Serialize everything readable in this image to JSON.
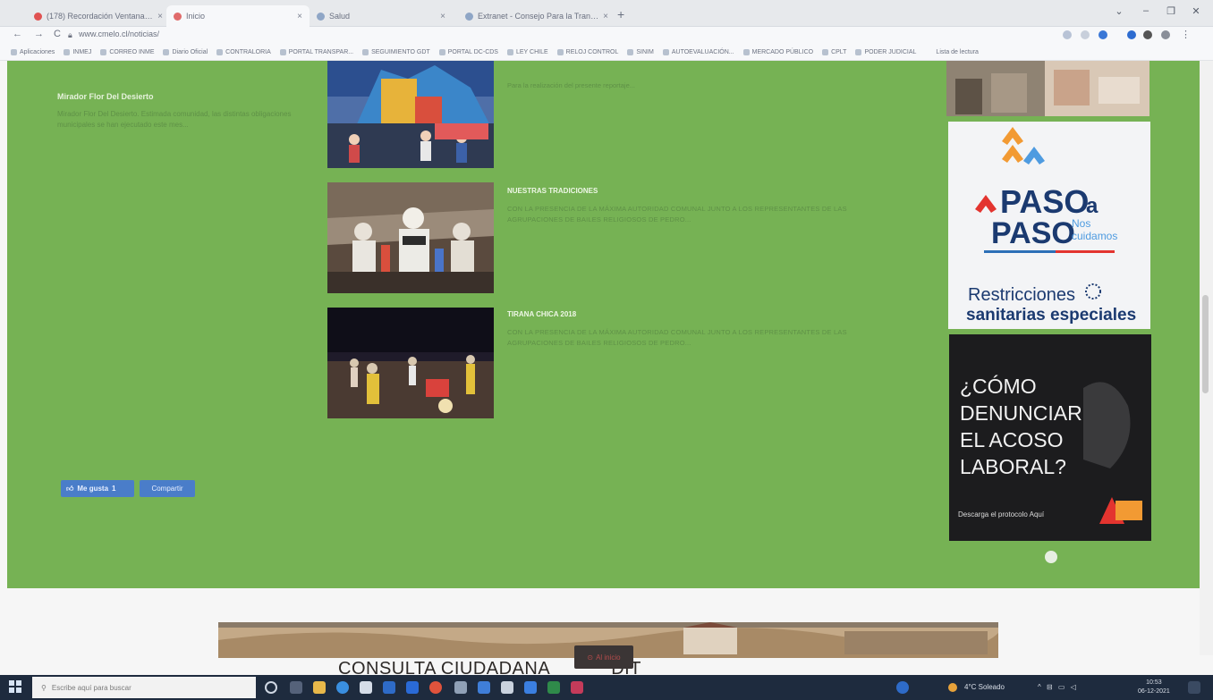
{
  "browser": {
    "tabs": [
      {
        "label": "(178) Recordación Ventanal - YouTube",
        "active": false
      },
      {
        "label": "Inicio",
        "active": true
      },
      {
        "label": "Salud",
        "active": false
      },
      {
        "label": "Extranet - Consejo Para la Transparencia",
        "active": false
      }
    ],
    "url": "www.cmelo.cl/noticias/",
    "bookmarks": [
      "Aplicaciones",
      "INMEJ",
      "CORREO INME",
      "Diario Oficial",
      "CONTRALORIA",
      "PORTAL TRANSPAR...",
      "SEGUIMIENTO GDT",
      "PORTAL DC-CDS",
      "LEY CHILE",
      "RELOJ CONTROL",
      "SINIM",
      "AUTOEVALUACIÓN...",
      "MERCADO PÚBLICO",
      "CPLT",
      "PODER JUDICIAL"
    ],
    "reading_list": "Lista de lectura"
  },
  "sidebar": {
    "title": "Mirador Flor Del Desierto",
    "text": "Mirador Flor Del Desierto. Estimada comunidad, las distintas obligaciones municipales se han ejecutado este mes..."
  },
  "news": {
    "clipped_text": "Para la realización del presente reportaje...",
    "items": [
      {
        "title": "NUESTRAS TRADICIONES",
        "text": "CON LA PRESENCIA DE LA MÁXIMA AUTORIDAD COMUNAL JUNTO A LOS REPRESENTANTES DE LAS AGRUPACIONES DE BAILES RELIGIOSOS DE PEDRO..."
      },
      {
        "title": "TIRANA CHICA 2018",
        "text": "CON LA PRESENCIA DE LA MÁXIMA AUTORIDAD COMUNAL JUNTO A LOS REPRESENTANTES DE LAS AGRUPACIONES DE BAILES RELIGIOSOS DE PEDRO..."
      }
    ]
  },
  "social": {
    "like_label": "Me gusta",
    "like_count": "1",
    "share_label": "Compartir"
  },
  "banners": {
    "paso_line1": "PASO",
    "paso_a": "a",
    "paso_line2": "PASO",
    "nos": "Nos",
    "cuidamos": "cuidamos",
    "restricciones_line1": "Restricciones",
    "restricciones_line2": "sanitarias especiales",
    "acoso_lines": [
      "¿CÓMO",
      "DENUNCIAR",
      "EL ACOSO",
      "LABORAL?"
    ],
    "acoso_sub": "Descarga el protocolo Aquí",
    "colors": {
      "green": "#76b254",
      "paso_orange": "#f29a33",
      "paso_blue": "#2c6fb7",
      "paso_red": "#e3342f",
      "navy": "#1b3a70"
    }
  },
  "lower": {
    "title": "CONSULTA CIUDADANA",
    "title_tail": "DIT",
    "go_top": "Al inicio"
  },
  "taskbar": {
    "search_placeholder": "Escribe aquí para buscar",
    "weather": "4°C Soleado",
    "time": "10:53",
    "date": "06-12-2021"
  }
}
